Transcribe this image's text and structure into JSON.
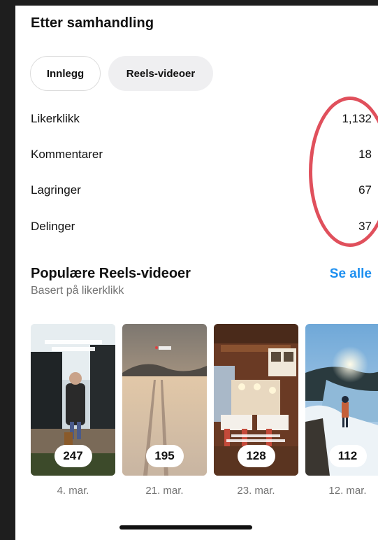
{
  "section": {
    "title": "Etter samhandling"
  },
  "tabs": [
    {
      "label": "Innlegg",
      "selected": false
    },
    {
      "label": "Reels-videoer",
      "selected": true
    }
  ],
  "metrics": [
    {
      "label": "Likerklikk",
      "value": "1,132"
    },
    {
      "label": "Kommentarer",
      "value": "18"
    },
    {
      "label": "Lagringer",
      "value": "67"
    },
    {
      "label": "Delinger",
      "value": "37"
    }
  ],
  "popular": {
    "title": "Populære Reels-videoer",
    "subtitle": "Basert på likerklikk",
    "see_all": "Se alle"
  },
  "reels": [
    {
      "count": "247",
      "date": "4. mar."
    },
    {
      "count": "195",
      "date": "21. mar."
    },
    {
      "count": "128",
      "date": "23. mar."
    },
    {
      "count": "112",
      "date": "12. mar."
    }
  ],
  "colors": {
    "accent": "#1d8ff0",
    "annotation": "#e0505c",
    "muted_text": "#737373",
    "pill_bg": "#efeff1"
  }
}
